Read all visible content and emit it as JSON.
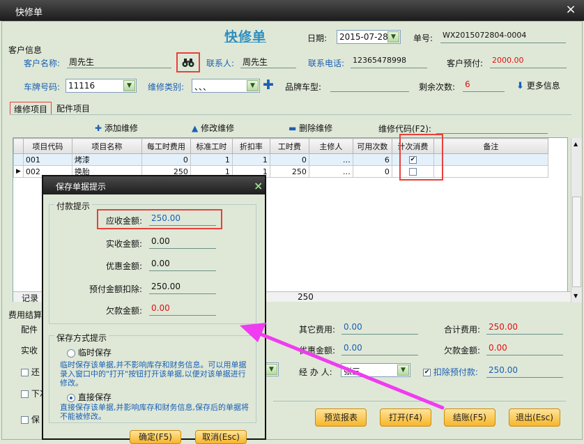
{
  "window": {
    "title": "快修单",
    "close_glyph": "×"
  },
  "header": {
    "title": "快修单",
    "date_label": "日期:",
    "date_value": "2015-07-28",
    "order_no_label": "单号:",
    "order_no_value": "WX2015072804-0004"
  },
  "customer": {
    "section_label": "客户信息",
    "name_label": "客户名称:",
    "name_value": "周先生",
    "contact_label": "联系人:",
    "contact_value": "周先生",
    "phone_label": "联系电话:",
    "phone_value": "12365478998",
    "prepay_label": "客户预付:",
    "prepay_value": "2000.00",
    "plate_label": "车牌号码:",
    "plate_value": "11116",
    "repair_type_label": "维修类别:",
    "repair_type_value": "、、、",
    "brand_label": "品牌车型:",
    "brand_value": "",
    "remaining_label": "剩余次数:",
    "remaining_value": "6",
    "more_info_label": "更多信息"
  },
  "tabs": [
    {
      "label": "维修项目"
    },
    {
      "label": "配件项目"
    }
  ],
  "toolbar": {
    "add_label": "添加维修",
    "edit_label": "修改维修",
    "delete_label": "删除维修",
    "code_label": "维修代码(F2):"
  },
  "table": {
    "columns": [
      "项目代码",
      "项目名称",
      "每工时费用",
      "标准工时",
      "折扣率",
      "工时费",
      "主修人",
      "可用次数",
      "计次消费",
      "备注"
    ],
    "rows": [
      {
        "code": "001",
        "name": "烤漆",
        "rate": "0",
        "std_hours": "1",
        "discount": "1",
        "labor": "0",
        "tech": "…",
        "uses": "6",
        "count": "✔"
      },
      {
        "code": "002",
        "name": "换胎",
        "rate": "250",
        "std_hours": "1",
        "discount": "1",
        "labor": "250",
        "tech": "…",
        "uses": "0",
        "count": ""
      }
    ],
    "footer_label": "记录",
    "footer_total": "250"
  },
  "settlement": {
    "section_label": "费用结算",
    "parts_label": "配件",
    "actual_label": "实收",
    "other_fee_label": "其它费用:",
    "other_fee_value": "0.00",
    "total_label": "合计费用:",
    "total_value": "250.00",
    "discount_label": "优惠金额:",
    "discount_value": "0.00",
    "debt_label": "欠款金额:",
    "debt_value": "0.00",
    "handler_label": "经 办 人:",
    "handler_value": "张三",
    "deduct_label": "扣除预付款:",
    "deduct_value": "250.00",
    "check_return": "还",
    "check_next": "下次",
    "check_save": "保"
  },
  "buttons": {
    "preview": "预览报表",
    "open": "打开(F4)",
    "checkout": "结账(F5)",
    "exit": "退出(Esc)"
  },
  "dialog": {
    "title": "保存单据提示",
    "close_glyph": "×",
    "pay_group": "付款提示",
    "receivable_label": "应收金额:",
    "receivable_value": "250.00",
    "received_label": "实收金额:",
    "received_value": "0.00",
    "discount_label": "优惠金额:",
    "discount_value": "0.00",
    "prepay_deduct_label": "预付金额扣除:",
    "prepay_deduct_value": "250.00",
    "debt_label": "欠款金额:",
    "debt_value": "0.00",
    "mode_group": "保存方式提示",
    "temp_label": "临时保存",
    "temp_note": "临时保存该单据,并不影响库存和财务信息。可以用单据录入窗口中的\"打开\"按钮打开该单据,以便对该单据进行修改。",
    "direct_label": "直接保存",
    "direct_note": "直接保存该单据,并影响库存和财务信息,保存后的单据将不能被修改。",
    "ok_label": "确定(F5)",
    "cancel_label": "取消(Esc)"
  },
  "colors": {
    "accent_red": "#e8403c",
    "arrow": "#f03cf0",
    "title_blue": "#2d8fbf"
  }
}
